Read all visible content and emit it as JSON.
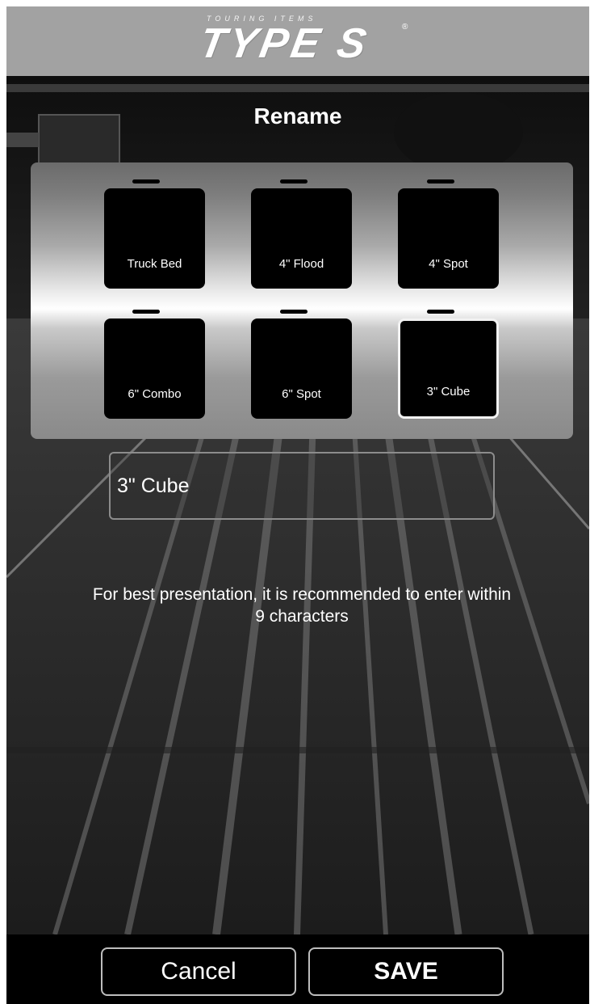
{
  "brand": {
    "tagline": "TOURING ITEMS",
    "name": "TYPE S",
    "mark": "®"
  },
  "title": "Rename",
  "buttons": [
    {
      "label": "Truck Bed",
      "selected": false
    },
    {
      "label": "4\" Flood",
      "selected": false
    },
    {
      "label": "4\" Spot",
      "selected": false
    },
    {
      "label": "6\" Combo",
      "selected": false
    },
    {
      "label": "6\" Spot",
      "selected": false
    },
    {
      "label": "3\" Cube",
      "selected": true
    }
  ],
  "name_input": {
    "value": "3\" Cube"
  },
  "hint": "For best presentation, it is recommended to enter within 9 characters",
  "actions": {
    "cancel": "Cancel",
    "save": "SAVE"
  },
  "colors": {
    "header_bg": "#a2a2a2",
    "tile_bg": "#000000",
    "accent": "#ffffff"
  }
}
